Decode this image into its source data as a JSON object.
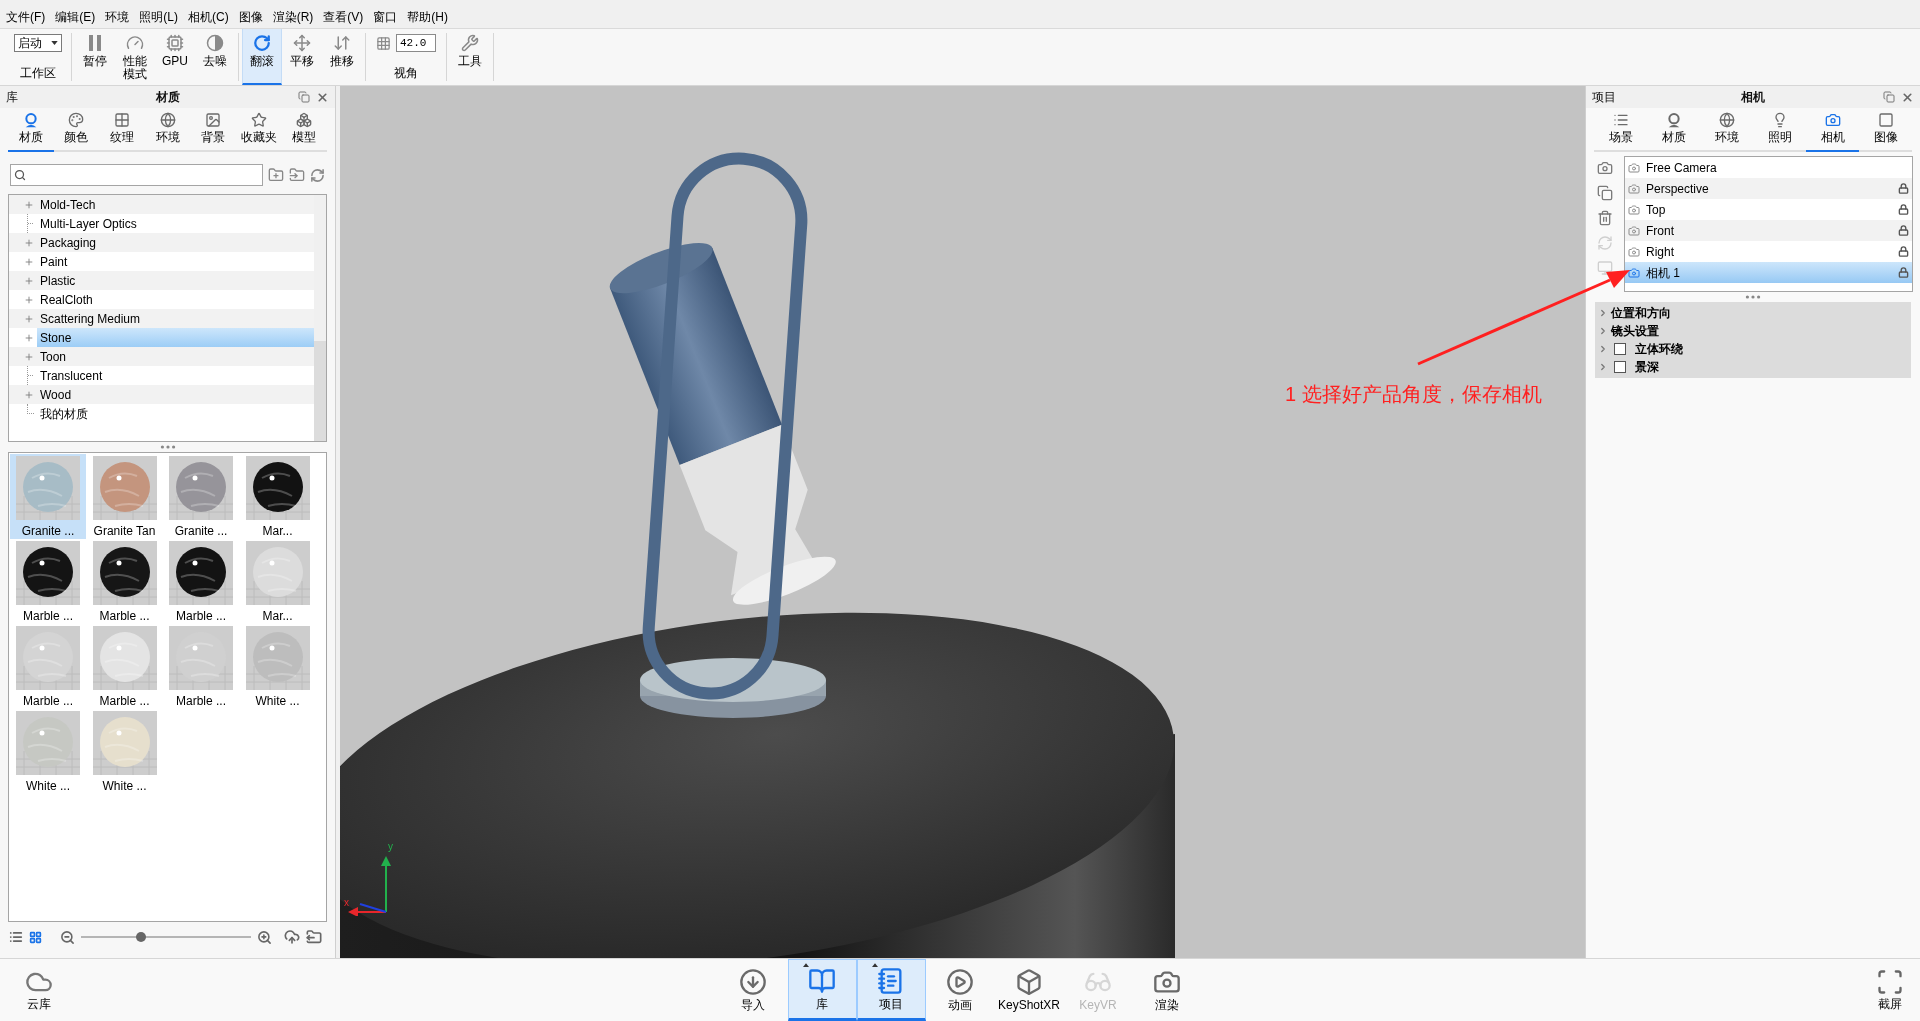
{
  "menu_bar": {
    "items": [
      "文件(F)",
      "编辑(E)",
      "环境",
      "照明(L)",
      "相机(C)",
      "图像",
      "渲染(R)",
      "查看(V)",
      "窗口",
      "帮助(H)"
    ]
  },
  "toolbar": {
    "workspace": {
      "value": "启动",
      "label": "工作区"
    },
    "buttons": [
      {
        "label": "暂停",
        "selected": false
      },
      {
        "label": "性能模式",
        "selected": false
      },
      {
        "label": "GPU",
        "selected": false
      },
      {
        "label": "去噪",
        "selected": false
      },
      {
        "label": "翻滚",
        "selected": true
      },
      {
        "label": "平移",
        "selected": false
      },
      {
        "label": "推移",
        "selected": false
      }
    ],
    "view_angle": {
      "value": "42.0",
      "label": "视角"
    },
    "tools": {
      "label": "工具"
    }
  },
  "library_panel": {
    "title": "库",
    "heading": "材质",
    "tabs": [
      {
        "label": "材质",
        "selected": true
      },
      {
        "label": "颜色",
        "selected": false
      },
      {
        "label": "纹理",
        "selected": false
      },
      {
        "label": "环境",
        "selected": false
      },
      {
        "label": "背景",
        "selected": false
      },
      {
        "label": "收藏夹",
        "selected": false
      },
      {
        "label": "模型",
        "selected": false
      }
    ],
    "tree": [
      {
        "label": "Mold-Tech",
        "expandable": true,
        "selected": false
      },
      {
        "label": "Multi-Layer Optics",
        "expandable": false,
        "selected": false
      },
      {
        "label": "Packaging",
        "expandable": true,
        "selected": false
      },
      {
        "label": "Paint",
        "expandable": true,
        "selected": false
      },
      {
        "label": "Plastic",
        "expandable": true,
        "selected": false
      },
      {
        "label": "RealCloth",
        "expandable": true,
        "selected": false
      },
      {
        "label": "Scattering Medium",
        "expandable": true,
        "selected": false
      },
      {
        "label": "Stone",
        "expandable": true,
        "selected": true
      },
      {
        "label": "Toon",
        "expandable": true,
        "selected": false
      },
      {
        "label": "Translucent",
        "expandable": false,
        "selected": false
      },
      {
        "label": "Wood",
        "expandable": true,
        "selected": false
      },
      {
        "label": "我的材质",
        "expandable": false,
        "selected": false
      }
    ],
    "thumbnails": [
      {
        "label": "Granite ...",
        "color": "#a7bcc6",
        "selected": true
      },
      {
        "label": "Granite Tan",
        "color": "#c4957e",
        "selected": false
      },
      {
        "label": "Granite ...",
        "color": "#96949a",
        "selected": false
      },
      {
        "label": "Mar...",
        "color": "#121212",
        "selected": false
      },
      {
        "label": "Marble ...",
        "color": "#141414",
        "selected": false
      },
      {
        "label": "Marble ...",
        "color": "#161616",
        "selected": false
      },
      {
        "label": "Marble ...",
        "color": "#131313",
        "selected": false
      },
      {
        "label": "Mar...",
        "color": "#dcdcdc",
        "selected": false
      },
      {
        "label": "Marble ...",
        "color": "#d4d4d4",
        "selected": false
      },
      {
        "label": "Marble ...",
        "color": "#e4e4e4",
        "selected": false
      },
      {
        "label": "Marble ...",
        "color": "#d0d0d0",
        "selected": false
      },
      {
        "label": "White ...",
        "color": "#bdbdbd",
        "selected": false
      },
      {
        "label": "White ...",
        "color": "#c6c8c3",
        "selected": false
      },
      {
        "label": "White ...",
        "color": "#e6dfcd",
        "selected": false
      }
    ],
    "zoom_slider": {
      "level": 0.35
    }
  },
  "viewport": {
    "axis_labels": [
      "y",
      "x"
    ],
    "annotation": "1 选择好产品角度，保存相机"
  },
  "project_panel": {
    "title": "项目",
    "heading": "相机",
    "tabs": [
      {
        "label": "场景",
        "selected": false
      },
      {
        "label": "材质",
        "selected": false
      },
      {
        "label": "环境",
        "selected": false
      },
      {
        "label": "照明",
        "selected": false
      },
      {
        "label": "相机",
        "selected": true
      },
      {
        "label": "图像",
        "selected": false
      }
    ],
    "side_tools": [
      {
        "disabled": false
      },
      {
        "disabled": false
      },
      {
        "disabled": false
      },
      {
        "disabled": true
      },
      {
        "disabled": true
      }
    ],
    "cameras": [
      {
        "label": "Free Camera",
        "locked": false,
        "selected": false
      },
      {
        "label": "Perspective",
        "locked": true,
        "selected": false
      },
      {
        "label": "Top",
        "locked": true,
        "selected": false
      },
      {
        "label": "Front",
        "locked": true,
        "selected": false
      },
      {
        "label": "Right",
        "locked": true,
        "selected": false
      },
      {
        "label": "相机 1",
        "locked": true,
        "selected": true
      }
    ],
    "properties": [
      {
        "kind": "section",
        "label": "位置和方向"
      },
      {
        "kind": "section",
        "label": "镜头设置"
      },
      {
        "kind": "toggle",
        "label": "立体环绕",
        "checked": false
      },
      {
        "kind": "toggle",
        "label": "景深",
        "checked": false
      }
    ]
  },
  "bottom_bar": {
    "cloud_library": {
      "label": "云库"
    },
    "buttons": [
      {
        "label": "导入",
        "selected": false,
        "disabled": false
      },
      {
        "label": "库",
        "selected": true,
        "disabled": false
      },
      {
        "label": "项目",
        "selected": true,
        "disabled": false
      },
      {
        "label": "动画",
        "selected": false,
        "disabled": false
      },
      {
        "label": "KeyShotXR",
        "selected": false,
        "disabled": false
      },
      {
        "label": "KeyVR",
        "selected": false,
        "disabled": true
      },
      {
        "label": "渲染",
        "selected": false,
        "disabled": false
      }
    ],
    "screenshot": {
      "label": "截屏"
    }
  }
}
